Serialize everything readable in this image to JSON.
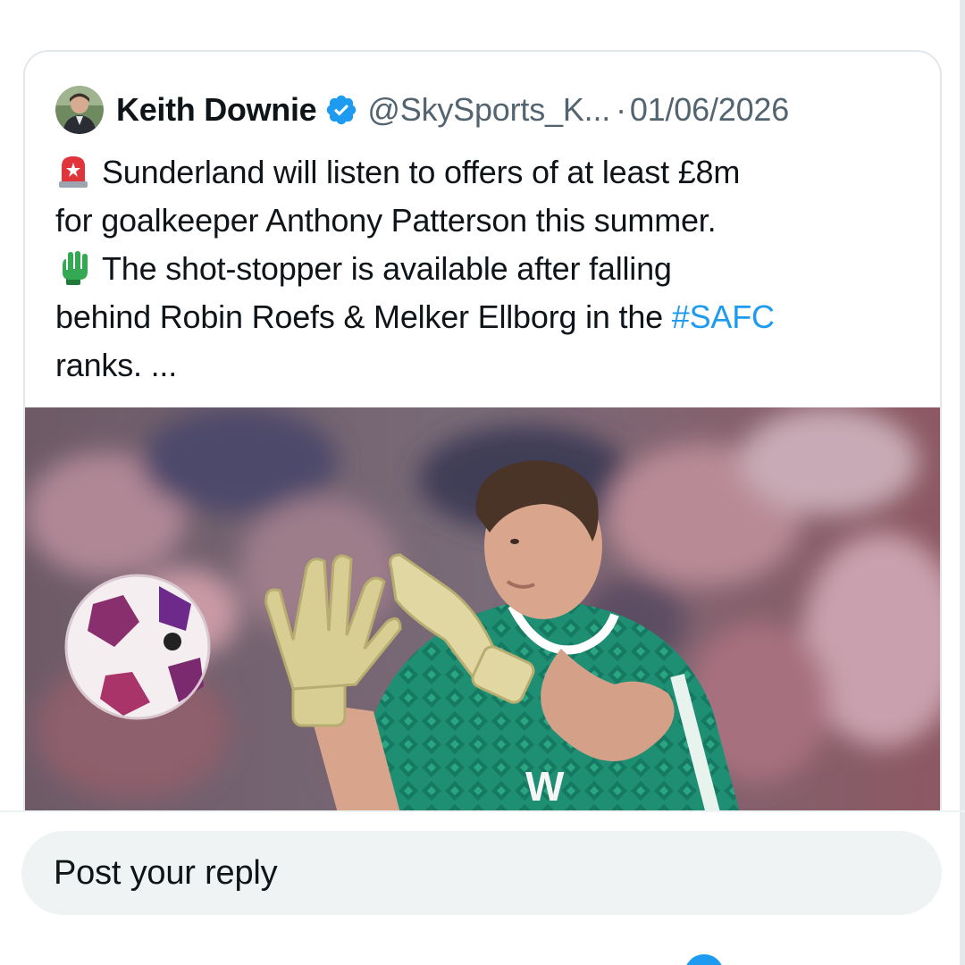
{
  "tweet": {
    "author_name": "Keith Downie",
    "handle": "@SkySports_K...",
    "separator": "·",
    "date": "01/06/2026",
    "verified_icon": "verified-badge-icon",
    "body": {
      "line1": "Sunderland will listen to offers of at least £8m",
      "line2": "for goalkeeper Anthony Patterson this summer.",
      "line3": "The shot-stopper is available after falling",
      "line4_prefix": "behind Robin Roefs & Melker Ellborg in the ",
      "hashtag": "#SAFC",
      "line5": "ranks. ..."
    },
    "emojis": {
      "first": "siren-emoji",
      "second": "gloved-hand-emoji"
    },
    "media_description": "goalkeeper-catching-ball-photo"
  },
  "reply": {
    "placeholder": "Post your reply"
  },
  "colors": {
    "link": "#1d9bf0",
    "text_primary": "#0f1419",
    "text_secondary": "#536471",
    "reply_bg": "#eff3f4"
  }
}
